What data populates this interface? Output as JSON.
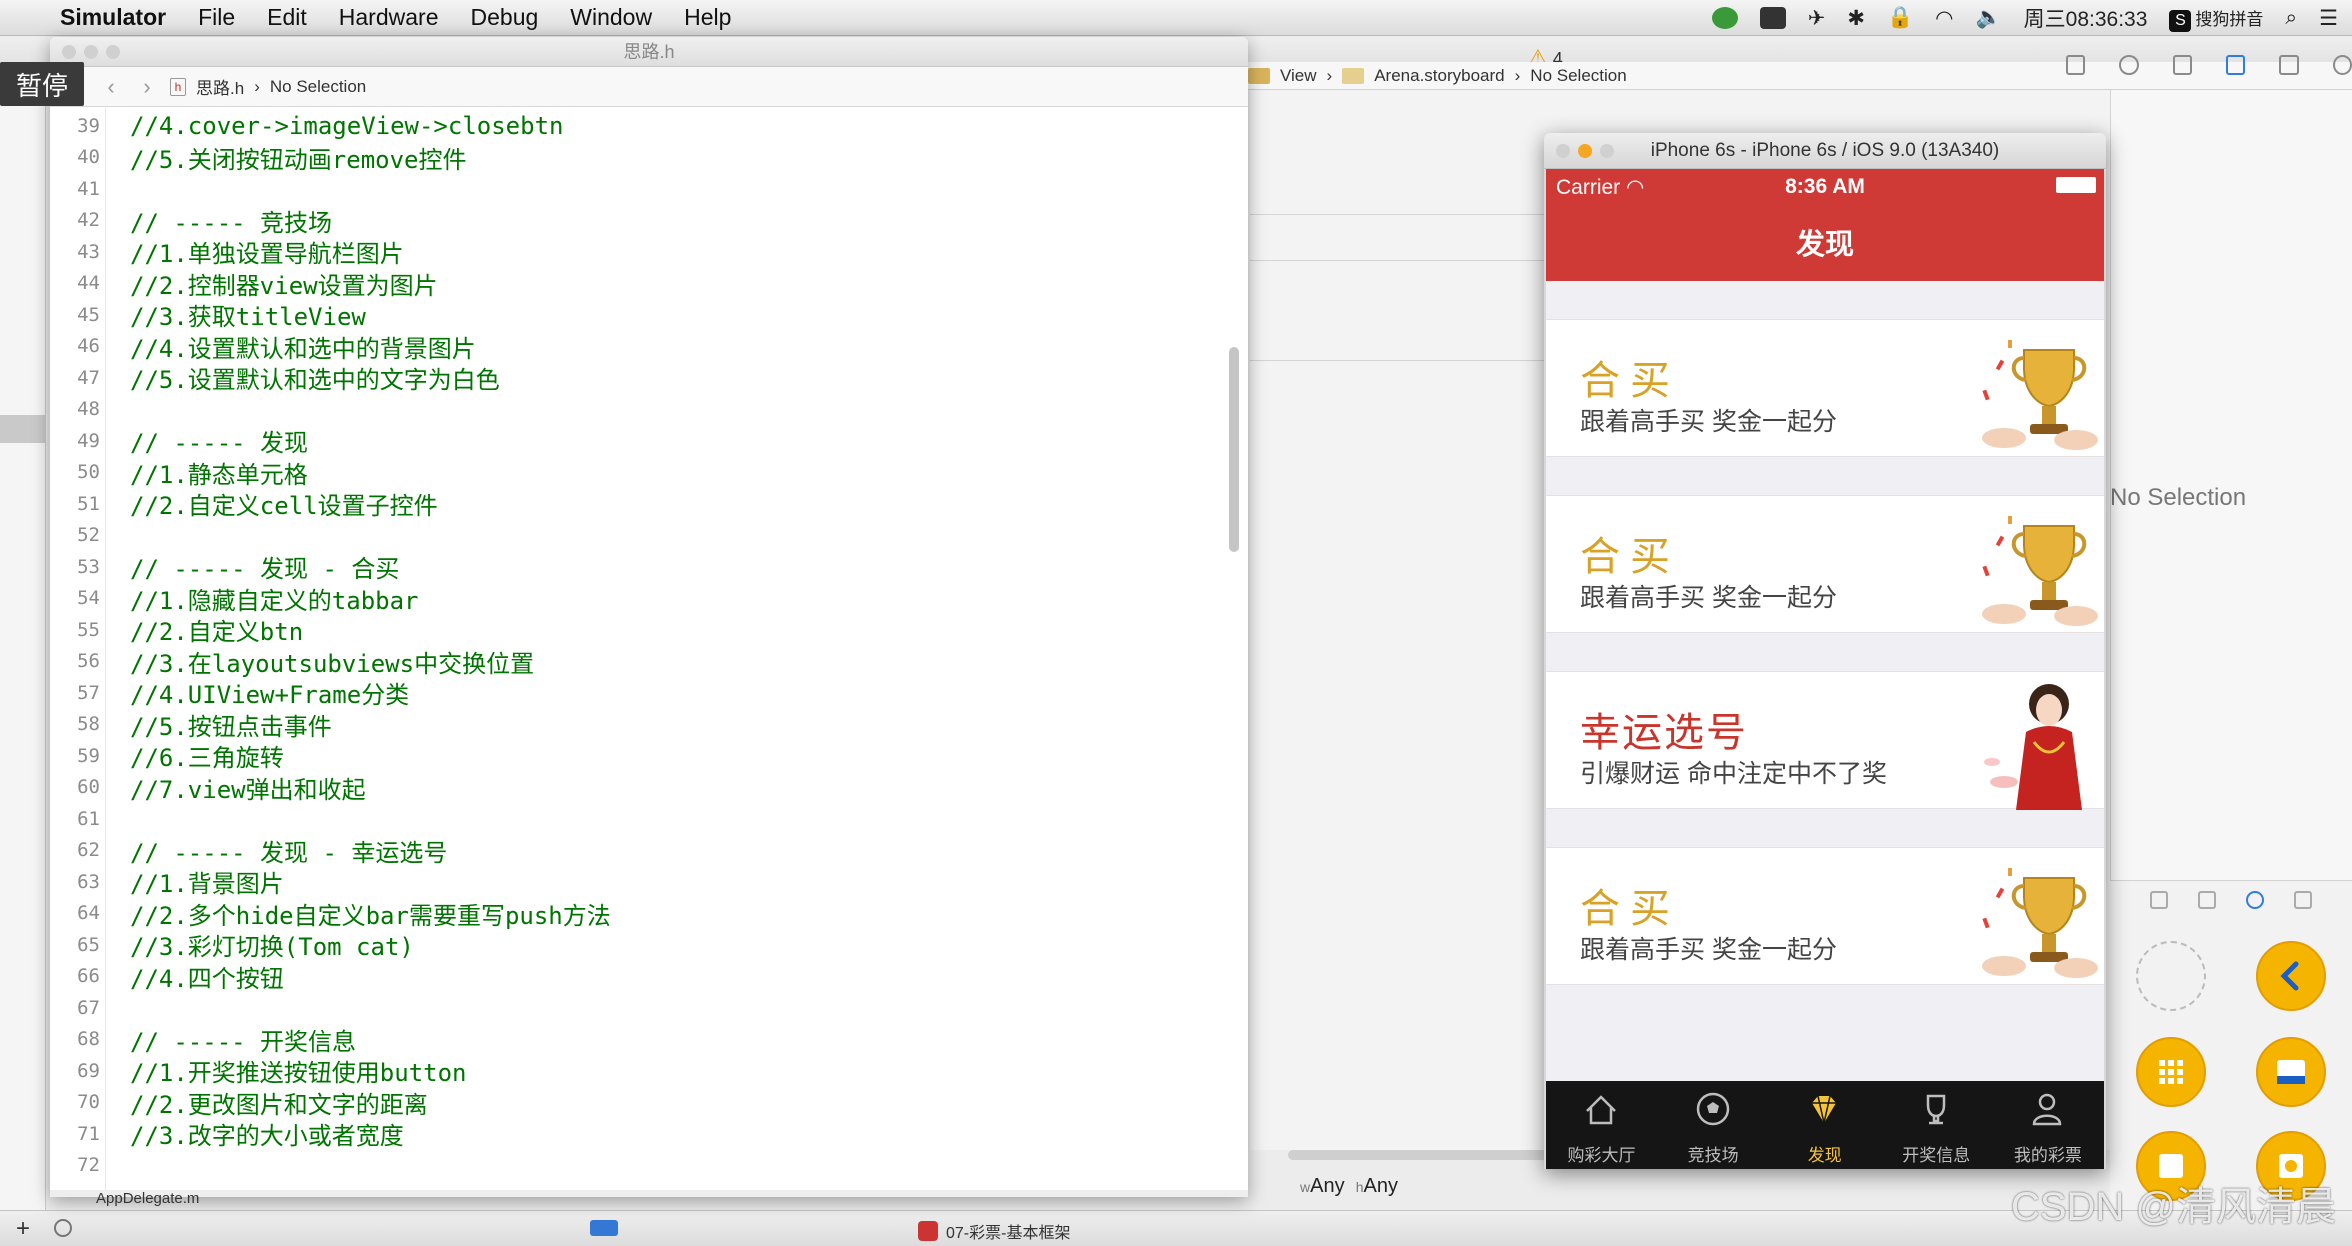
{
  "menubar": {
    "app": "Simulator",
    "items": [
      "File",
      "Edit",
      "Hardware",
      "Debug",
      "Window",
      "Help"
    ],
    "clock": "周三08:36:33",
    "ime": "搜狗拼音"
  },
  "pause_label": "暂停",
  "xcode": {
    "warning_count": "4",
    "jumpbar": [
      "View",
      "Arena.storyboard",
      "No Selection"
    ],
    "inspector_empty": "No Selection",
    "size_class": {
      "w": "w",
      "w_val": "Any",
      "h": "h",
      "h_val": "Any"
    },
    "scheme": "07-彩票-基本框架",
    "file_below": "AppDelegate.m"
  },
  "editor": {
    "title": "思路.h",
    "breadcrumb_file": "思路.h",
    "breadcrumb_sel": "No Selection",
    "file_icon": "h",
    "lines": [
      {
        "n": "39",
        "t": "//4.cover->imageView->closebtn"
      },
      {
        "n": "40",
        "t": "//5.关闭按钮动画remove控件"
      },
      {
        "n": "41",
        "t": ""
      },
      {
        "n": "42",
        "t": "// ----- 竞技场"
      },
      {
        "n": "43",
        "t": "//1.单独设置导航栏图片"
      },
      {
        "n": "44",
        "t": "//2.控制器view设置为图片"
      },
      {
        "n": "45",
        "t": "//3.获取titleView"
      },
      {
        "n": "46",
        "t": "//4.设置默认和选中的背景图片"
      },
      {
        "n": "47",
        "t": "//5.设置默认和选中的文字为白色"
      },
      {
        "n": "48",
        "t": ""
      },
      {
        "n": "49",
        "t": "// ----- 发现"
      },
      {
        "n": "50",
        "t": "//1.静态单元格"
      },
      {
        "n": "51",
        "t": "//2.自定义cell设置子控件"
      },
      {
        "n": "52",
        "t": ""
      },
      {
        "n": "53",
        "t": "// ----- 发现 - 合买"
      },
      {
        "n": "54",
        "t": "//1.隐藏自定义的tabbar"
      },
      {
        "n": "55",
        "t": "//2.自定义btn"
      },
      {
        "n": "56",
        "t": "//3.在layoutsubviews中交换位置"
      },
      {
        "n": "57",
        "t": "//4.UIView+Frame分类"
      },
      {
        "n": "58",
        "t": "//5.按钮点击事件"
      },
      {
        "n": "59",
        "t": "//6.三角旋转"
      },
      {
        "n": "60",
        "t": "//7.view弹出和收起"
      },
      {
        "n": "61",
        "t": ""
      },
      {
        "n": "62",
        "t": "// ----- 发现 - 幸运选号"
      },
      {
        "n": "63",
        "t": "//1.背景图片"
      },
      {
        "n": "64",
        "t": "//2.多个hide自定义bar需要重写push方法"
      },
      {
        "n": "65",
        "t": "//3.彩灯切换(Tom cat)"
      },
      {
        "n": "66",
        "t": "//4.四个按钮"
      },
      {
        "n": "67",
        "t": ""
      },
      {
        "n": "68",
        "t": "// ----- 开奖信息"
      },
      {
        "n": "69",
        "t": "//1.开奖推送按钮使用button"
      },
      {
        "n": "70",
        "t": "//2.更改图片和文字的距离"
      },
      {
        "n": "71",
        "t": "//3.改字的大小或者宽度"
      },
      {
        "n": "72",
        "t": ""
      }
    ]
  },
  "simulator": {
    "title": "iPhone 6s - iPhone 6s / iOS 9.0 (13A340)",
    "carrier": "Carrier",
    "time": "8:36 AM",
    "nav_title": "发现",
    "cells": [
      {
        "title": "合买",
        "subtitle": "跟着高手买 奖金一起分",
        "style": "gold",
        "art": "trophy-icon"
      },
      {
        "title": "合买",
        "subtitle": "跟着高手买 奖金一起分",
        "style": "gold",
        "art": "trophy-icon"
      },
      {
        "title": "幸运选号",
        "subtitle": "引爆财运 命中注定中不了奖",
        "style": "red",
        "art": "lucky-girl-illustration"
      },
      {
        "title": "合买",
        "subtitle": "跟着高手买 奖金一起分",
        "style": "gold",
        "art": "trophy-icon"
      }
    ],
    "tabs": [
      {
        "label": "购彩大厅",
        "icon": "home-icon",
        "selected": false
      },
      {
        "label": "竞技场",
        "icon": "soccer-ball-icon",
        "selected": false
      },
      {
        "label": "发现",
        "icon": "diamond-icon",
        "selected": true
      },
      {
        "label": "开奖信息",
        "icon": "trophy-icon",
        "selected": false
      },
      {
        "label": "我的彩票",
        "icon": "user-icon",
        "selected": false
      }
    ]
  },
  "watermark": "CSDN @清风清晨",
  "colors": {
    "nav_red": "#d03a36",
    "gold": "#d9a227",
    "code_green": "#007400",
    "tab_selected": "#f5c33a"
  }
}
